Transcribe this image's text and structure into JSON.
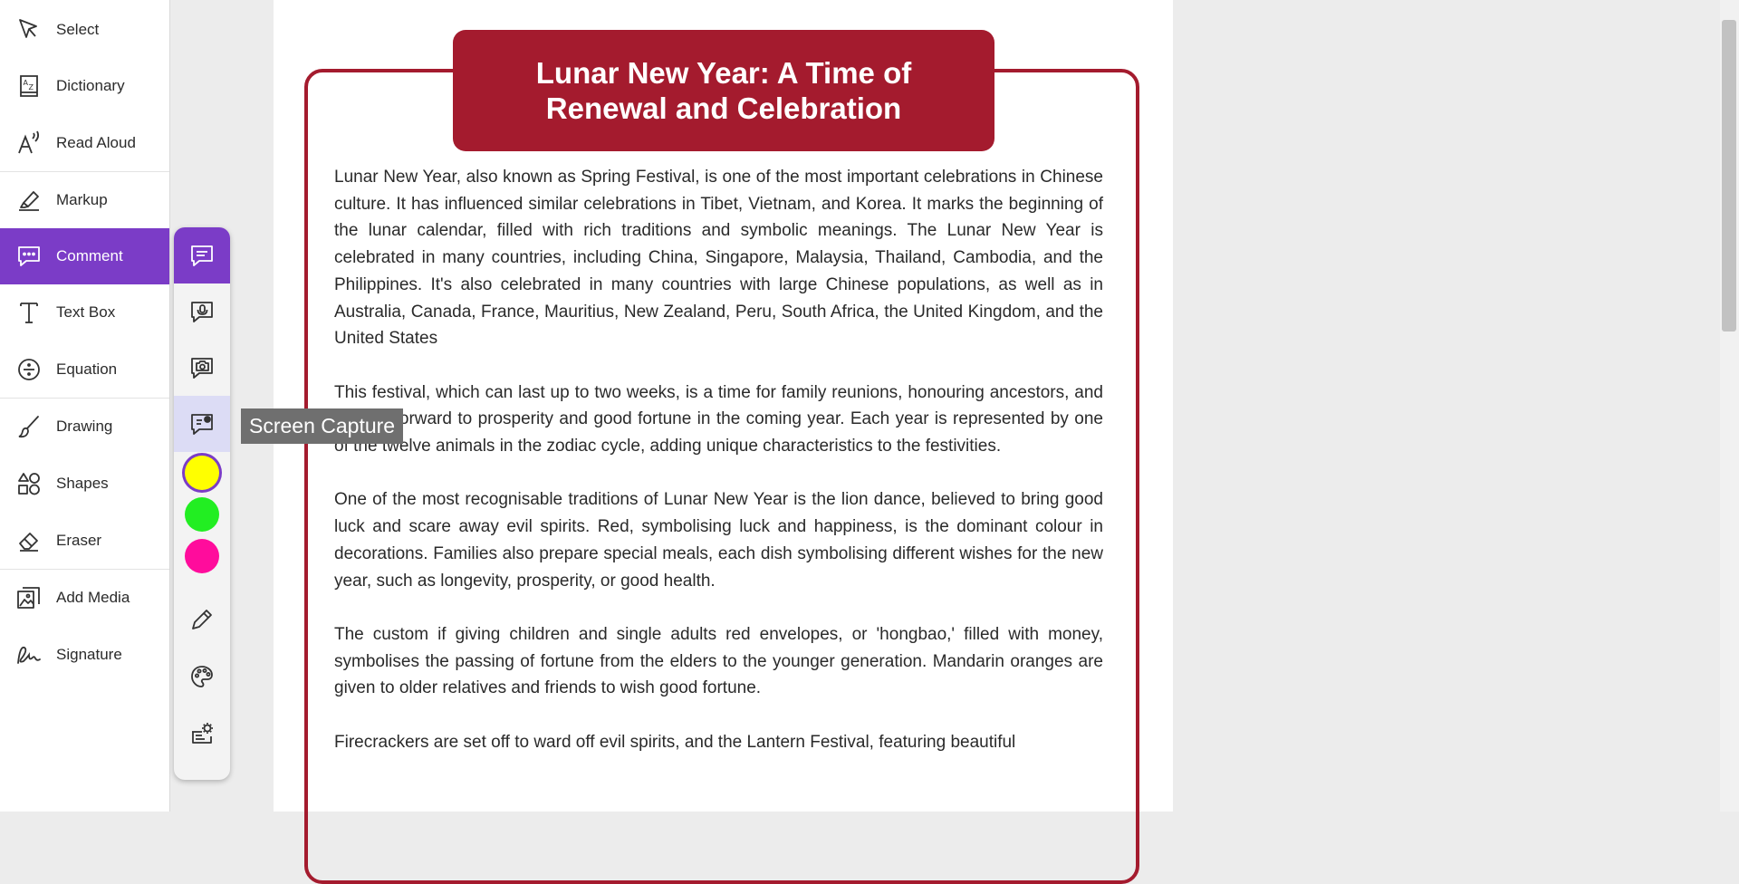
{
  "toolbar": {
    "items": [
      {
        "label": "Select",
        "icon": "cursor-icon"
      },
      {
        "label": "Dictionary",
        "icon": "dictionary-icon"
      },
      {
        "label": "Read Aloud",
        "icon": "read-aloud-icon"
      },
      {
        "label": "Markup",
        "icon": "highlighter-icon"
      },
      {
        "label": "Comment",
        "icon": "comment-icon",
        "active": true
      },
      {
        "label": "Text Box",
        "icon": "text-icon"
      },
      {
        "label": "Equation",
        "icon": "divide-icon"
      },
      {
        "label": "Drawing",
        "icon": "brush-icon"
      },
      {
        "label": "Shapes",
        "icon": "shapes-icon"
      },
      {
        "label": "Eraser",
        "icon": "eraser-icon"
      },
      {
        "label": "Add Media",
        "icon": "image-icon"
      },
      {
        "label": "Signature",
        "icon": "signature-icon"
      }
    ]
  },
  "comment_panel": {
    "tools": [
      "text-comment-icon",
      "voice-comment-icon",
      "video-comment-icon",
      "screen-capture-icon"
    ],
    "active_tool": "text-comment-icon",
    "hovered_tool": "screen-capture-icon",
    "colors": [
      "#ffff00",
      "#22ee22",
      "#ff0c9c"
    ],
    "selected_color": "#ffff00",
    "bottom_tools": [
      "pencil-icon",
      "palette-icon",
      "settings-icon"
    ]
  },
  "tooltip": {
    "text": "Screen Capture"
  },
  "document": {
    "title": "Lunar New Year: A Time of Renewal and Celebration",
    "paragraphs": [
      "Lunar New Year, also known as Spring Festival, is one of the most important celebrations in Chinese culture. It has influenced similar celebrations in Tibet, Vietnam, and Korea. It marks the beginning of the lunar calendar, filled with rich traditions and symbolic meanings. The Lunar New Year is celebrated in many countries, including China, Singapore, Malaysia, Thailand, Cambodia, and the Philippines. It's also celebrated in many countries with large Chinese populations, as well as in Australia, Canada, France, Mauritius, New Zealand, Peru, South Africa, the United Kingdom, and the United States",
      "This festival, which can last up to two weeks, is a time for family reunions, honouring ancestors, and looking forward to prosperity and good fortune in the coming year. Each year is represented by one of the twelve animals in the zodiac cycle, adding unique characteristics to the festivities.",
      "One of the most recognisable traditions of Lunar New Year is the lion dance, believed to bring good luck and scare away evil spirits. Red, symbolising luck and happiness, is the dominant colour in decorations. Families also prepare special meals, each dish symbolising different wishes for the new year, such as longevity, prosperity, or good health.",
      "The custom if giving children and single adults red envelopes, or 'hongbao,' filled with money, symbolises the passing of fortune from the elders to the younger generation. Mandarin oranges are given to older relatives and friends to wish good fortune.",
      "Firecrackers are set off to ward off evil spirits, and the Lantern Festival, featuring beautiful"
    ]
  },
  "colors": {
    "accent": "#7b3cc7",
    "brand_red": "#a41b2e",
    "hover_bg": "#dcdcf5"
  }
}
